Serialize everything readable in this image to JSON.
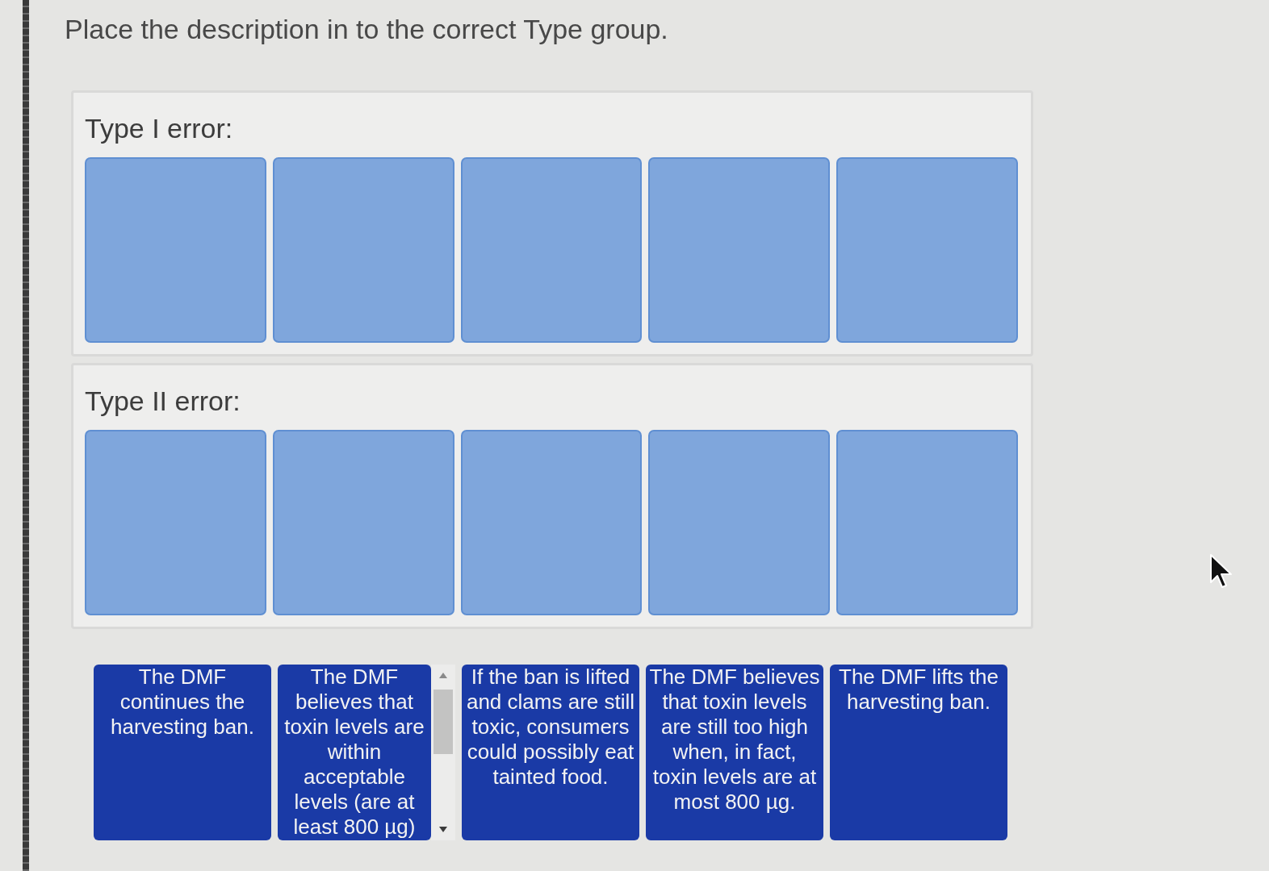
{
  "instruction": "Place the description in to the correct Type group.",
  "groups": [
    {
      "label": "Type I error:",
      "slots": [
        {
          "filled": false
        },
        {
          "filled": false
        },
        {
          "filled": false
        },
        {
          "filled": false
        },
        {
          "filled": false
        }
      ]
    },
    {
      "label": "Type II error:",
      "slots": [
        {
          "filled": false
        },
        {
          "filled": false
        },
        {
          "filled": false
        },
        {
          "filled": false
        },
        {
          "filled": false
        }
      ]
    }
  ],
  "cards": [
    {
      "text": "The DMF continues the harvesting ban.",
      "scrollable": false
    },
    {
      "text": "The DMF believes that toxin levels are within acceptable levels (are at least 800 µg)",
      "scrollable": true
    },
    {
      "text": "If the ban is lifted and clams are still toxic, consumers could possibly eat tainted food.",
      "scrollable": false
    },
    {
      "text": "The DMF believes that toxin levels are still too high when, in fact, toxin levels are at most 800 µg.",
      "scrollable": false
    },
    {
      "text": "The DMF lifts the harvesting ban.",
      "scrollable": false
    }
  ]
}
